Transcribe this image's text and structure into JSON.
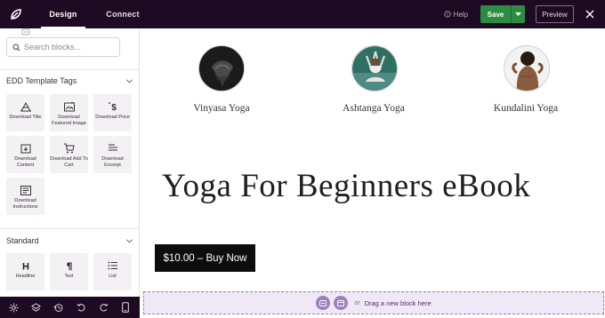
{
  "topbar": {
    "tabs": [
      "Design",
      "Connect"
    ],
    "help_label": "Help",
    "save_label": "Save",
    "preview_label": "Preview"
  },
  "sidebar": {
    "search_placeholder": "Search blocks...",
    "sections": [
      {
        "title": "EDD Template Tags",
        "blocks": [
          {
            "label": "Download Title",
            "icon": "title-icon"
          },
          {
            "label": "Download Featured Image",
            "icon": "featured-image-icon"
          },
          {
            "label": "Download Price",
            "icon": "price-icon"
          },
          {
            "label": "Download Content",
            "icon": "content-icon"
          },
          {
            "label": "Download Add To Cart",
            "icon": "cart-icon"
          },
          {
            "label": "Download Excerpt",
            "icon": "excerpt-icon"
          },
          {
            "label": "Download Instructions",
            "icon": "instructions-icon"
          }
        ]
      },
      {
        "title": "Standard",
        "blocks": [
          {
            "label": "Headline",
            "icon": "headline-icon"
          },
          {
            "label": "Text",
            "icon": "paragraph-icon"
          },
          {
            "label": "List",
            "icon": "list-icon"
          }
        ]
      }
    ]
  },
  "bottombar": {
    "icons": [
      "settings-icon",
      "layers-icon",
      "history-icon",
      "undo-icon",
      "redo-icon",
      "mobile-preview-icon"
    ]
  },
  "canvas": {
    "yoga_items": [
      {
        "label": "Vinyasa Yoga"
      },
      {
        "label": "Ashtanga Yoga"
      },
      {
        "label": "Kundalini Yoga"
      }
    ],
    "title": "Yoga For Beginners eBook",
    "buy_button": "$10.00 – Buy Now",
    "drop_zone": {
      "or": "or",
      "text": "Drag a new block here"
    }
  },
  "colors": {
    "topbar_bg": "#1e0a22",
    "save_green": "#2e8b44",
    "drop_zone_bg": "#f0e8f6",
    "drop_zone_border": "#9a7bb5",
    "block_bg": "#f3f1f3"
  }
}
